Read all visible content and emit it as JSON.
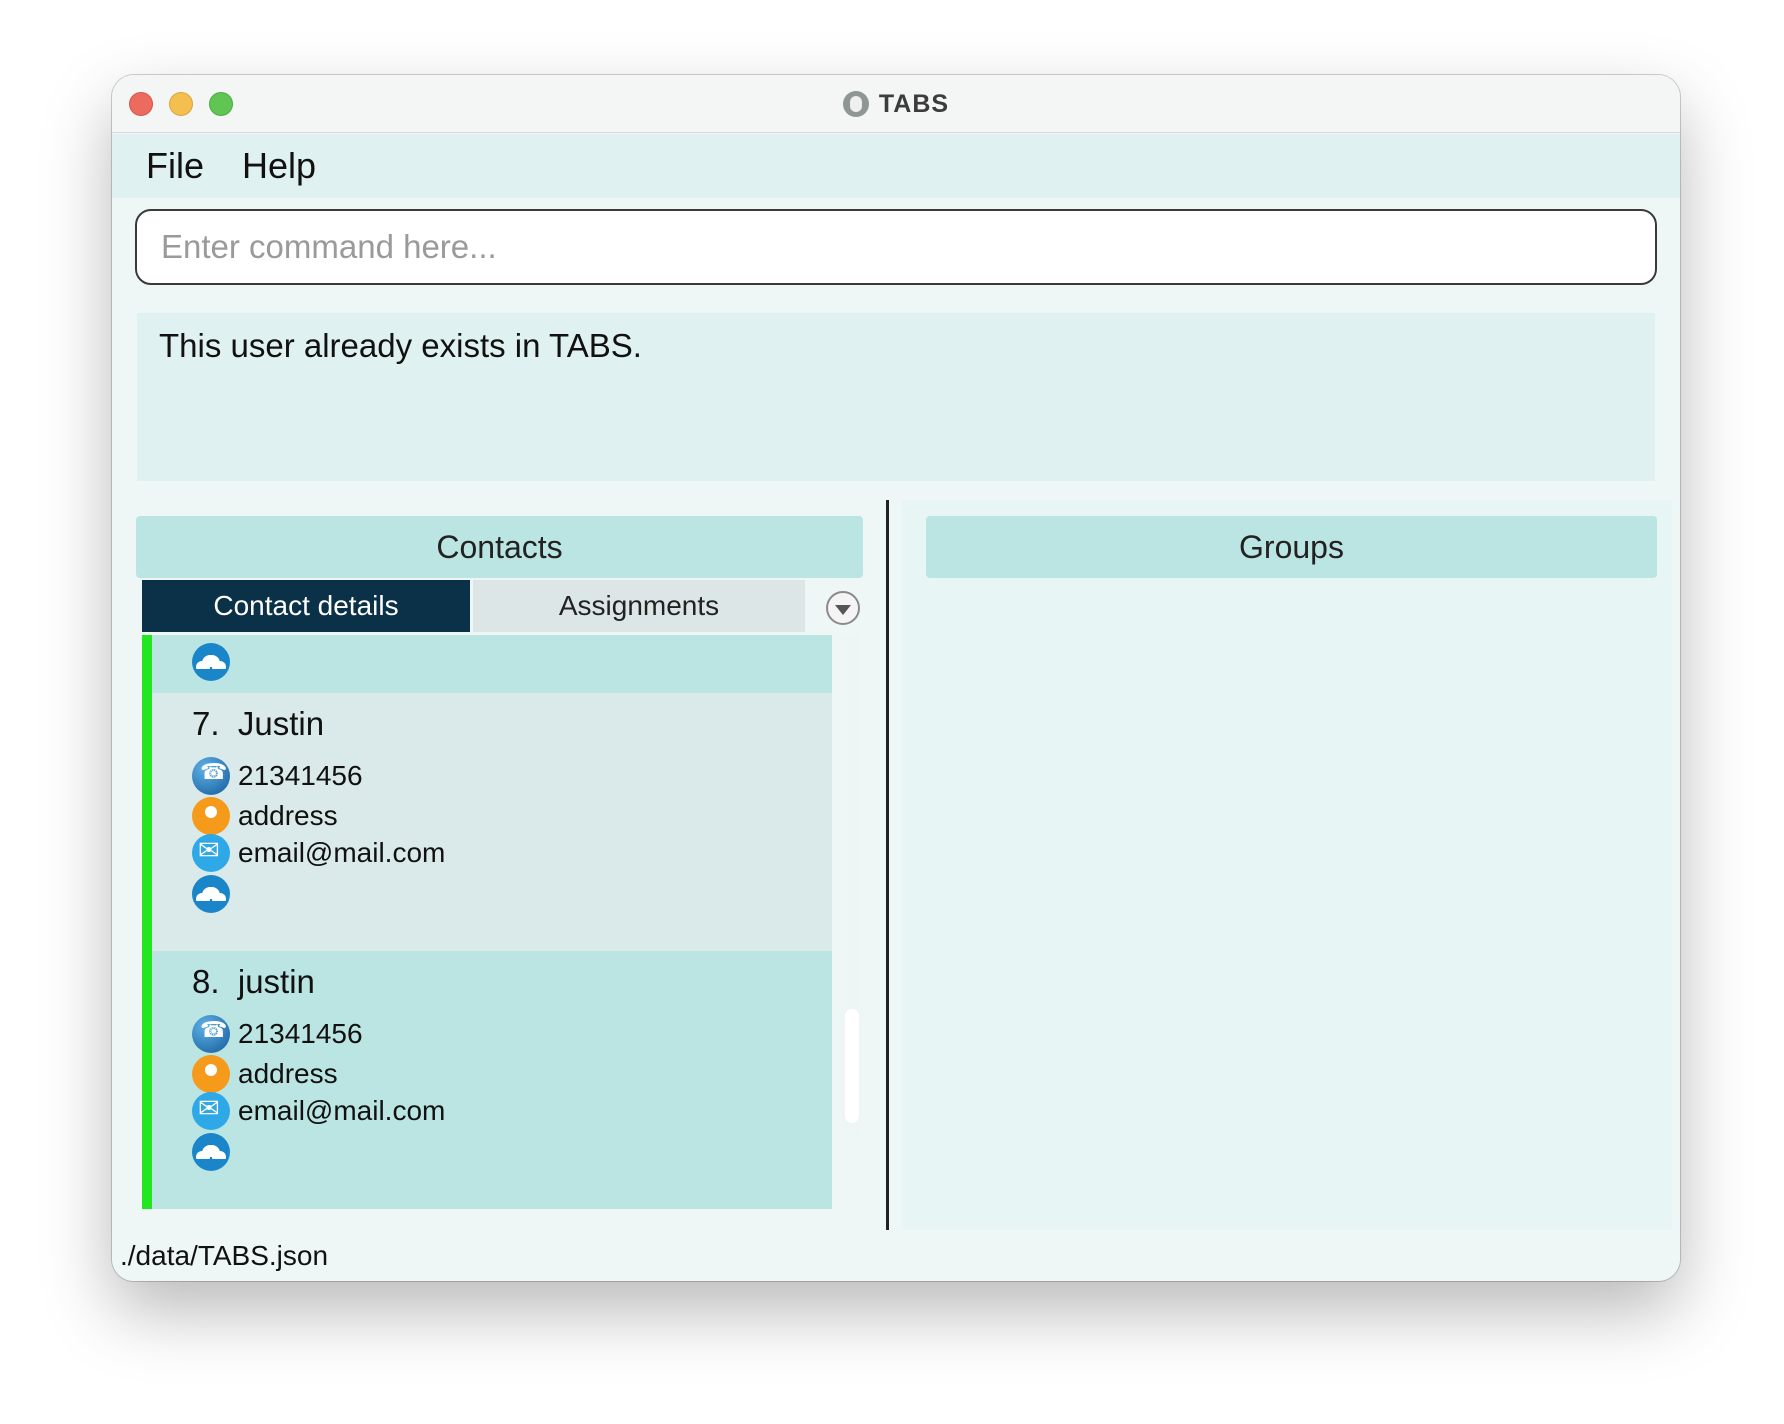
{
  "window": {
    "title": "TABS"
  },
  "menu": {
    "items": [
      {
        "label": "File"
      },
      {
        "label": "Help"
      }
    ]
  },
  "command": {
    "placeholder": "Enter command here...",
    "value": ""
  },
  "result": {
    "message": "This user already exists in TABS."
  },
  "contacts_panel": {
    "title": "Contacts",
    "tabs": [
      {
        "label": "Contact details",
        "selected": true
      },
      {
        "label": "Assignments",
        "selected": false
      }
    ],
    "contacts": [
      {
        "index": "7.",
        "name": "Justin",
        "phone": "21341456",
        "address": "address",
        "email": "email@mail.com"
      },
      {
        "index": "8.",
        "name": "justin",
        "phone": "21341456",
        "address": "address",
        "email": "email@mail.com"
      }
    ]
  },
  "groups_panel": {
    "title": "Groups"
  },
  "status": {
    "file_path": "./data/TABS.json"
  },
  "icons": {
    "phone": "phone-icon",
    "address": "location-pin-icon",
    "email": "email-icon",
    "groups": "group-icon",
    "app": "paw-icon"
  },
  "colors": {
    "accent_tab": "#0b3148",
    "header_bg": "#bbe5e3",
    "card_stripe": "#22e61f"
  }
}
